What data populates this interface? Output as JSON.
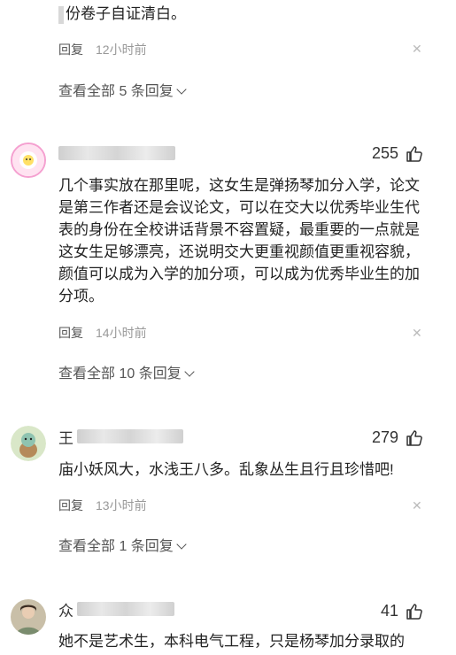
{
  "colors": {
    "text": "#222222",
    "meta": "#999999",
    "link": "#555555",
    "background": "#ffffff"
  },
  "top_comment": {
    "text_fragment": "份卷子自证清白。",
    "reply_label": "回复",
    "time": "12小时前",
    "view_all": "查看全部 5 条回复"
  },
  "comments": [
    {
      "likes": "255",
      "text": "几个事实放在那里呢，这女生是弹扬琴加分入学，论文是第三作者还是会议论文，可以在交大以优秀毕业生代表的身份在全校讲话背景不容置疑，最重要的一点就是这女生足够漂亮，还说明交大更重视颜值更重视容貌，颜值可以成为入学的加分项，可以成为优秀毕业生的加分项。",
      "reply_label": "回复",
      "time": "14小时前",
      "view_all": "查看全部 10 条回复",
      "avatar_icon": "flower-avatar-icon"
    },
    {
      "name_prefix": "王",
      "likes": "279",
      "text": "庙小妖风大，水浅王八多。乱象丛生且行且珍惜吧!",
      "reply_label": "回复",
      "time": "13小时前",
      "view_all": "查看全部 1 条回复",
      "avatar_icon": "cartoon-avatar-icon"
    },
    {
      "name_prefix": "众",
      "likes": "41",
      "text": "她不是艺术生，本科电气工程，只是杨琴加分录取的",
      "avatar_icon": "photo-avatar-icon"
    }
  ]
}
